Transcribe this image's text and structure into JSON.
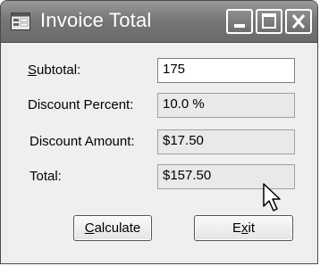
{
  "window": {
    "title": "Invoice Total",
    "icon": "form-icon",
    "controls": {
      "minimize": "minimize-icon",
      "maximize": "maximize-icon",
      "close": "close-icon"
    }
  },
  "form": {
    "subtotal": {
      "label": "Subtotal:",
      "value": "175"
    },
    "discount_percent": {
      "label": "Discount Percent:",
      "value": "10.0 %"
    },
    "discount_amount": {
      "label": "Discount Amount:",
      "value": "$17.50"
    },
    "total": {
      "label": "Total:",
      "value": "$157.50"
    }
  },
  "buttons": {
    "calculate": "Calculate",
    "exit": "Exit"
  },
  "colors": {
    "titlebar": "#777777",
    "form_background": "#efefef",
    "readonly_field": "#e9e9e9"
  }
}
